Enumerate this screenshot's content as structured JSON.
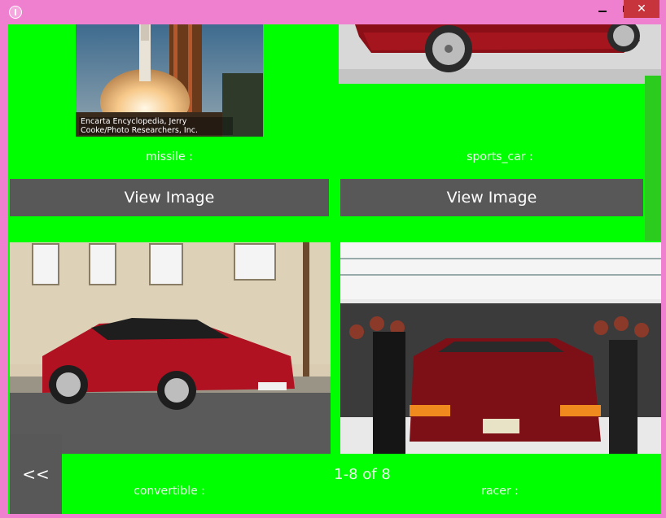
{
  "window": {
    "title_icon": "app-icon",
    "controls": {
      "minimize": "minimize-icon",
      "maximize": "maximize-icon",
      "close": "✕"
    }
  },
  "cards": [
    {
      "label": "missile :",
      "button": "View Image",
      "caption": "Encarta Encyclopedia, Jerry Cooke/Photo Researchers, Inc."
    },
    {
      "label": "sports_car :",
      "button": "View Image"
    },
    {
      "label": "convertible :"
    },
    {
      "label": "racer :"
    }
  ],
  "pager": {
    "prev": "<<",
    "status": "1-8 of 8"
  },
  "colors": {
    "frame": "#ef7fcf",
    "background": "#00ff00",
    "button": "#585858",
    "scrollbar": "#2ccc1e"
  }
}
